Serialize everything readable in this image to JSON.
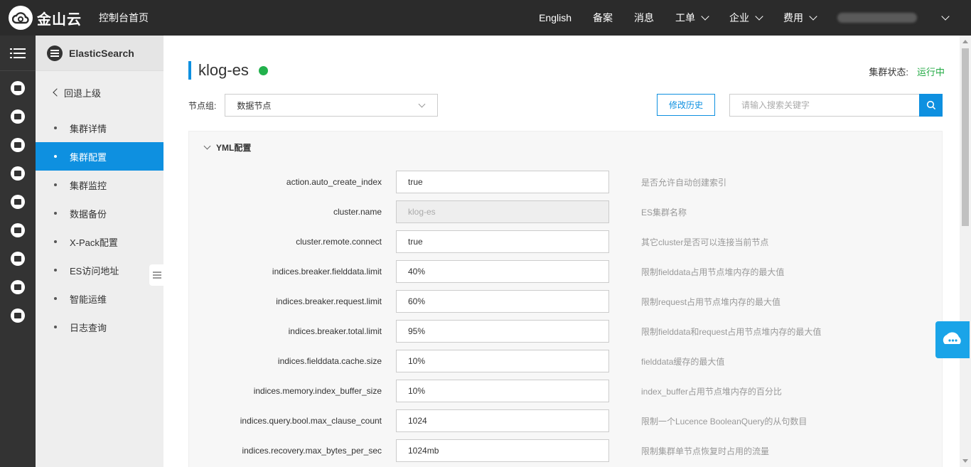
{
  "topbar": {
    "brand": "金山云",
    "console_home": "控制台首页",
    "nav": [
      {
        "label": "English",
        "has_dropdown": false
      },
      {
        "label": "备案",
        "has_dropdown": false
      },
      {
        "label": "消息",
        "has_dropdown": false
      },
      {
        "label": "工单",
        "has_dropdown": true
      },
      {
        "label": "企业",
        "has_dropdown": true
      },
      {
        "label": "费用",
        "has_dropdown": true
      }
    ]
  },
  "rail": {
    "icons": [
      "menu-icon",
      "database-icon",
      "server-icon",
      "network-icon",
      "cloud-icon",
      "storage-icon",
      "layers-icon",
      "cloud-upload-icon",
      "mail-icon",
      "id-card-icon"
    ]
  },
  "sidebar": {
    "product": "ElasticSearch",
    "back": "回退上级",
    "items": [
      {
        "label": "集群详情",
        "active": false
      },
      {
        "label": "集群配置",
        "active": true
      },
      {
        "label": "集群监控",
        "active": false
      },
      {
        "label": "数据备份",
        "active": false
      },
      {
        "label": "X-Pack配置",
        "active": false
      },
      {
        "label": "ES访问地址",
        "active": false
      },
      {
        "label": "智能运维",
        "active": false
      },
      {
        "label": "日志查询",
        "active": false
      }
    ]
  },
  "main": {
    "title": "klog-es",
    "status_label": "集群状态:",
    "status_value": "运行中",
    "status_color": "#22aa44",
    "node_group_label": "节点组:",
    "node_group_value": "数据节点",
    "history_button": "修改历史",
    "search_placeholder": "请输入搜索关键字",
    "section_title": "YML配置",
    "config": [
      {
        "key": "action.auto_create_index",
        "value": "true",
        "desc": "是否允许自动创建索引",
        "disabled": false
      },
      {
        "key": "cluster.name",
        "value": "klog-es",
        "desc": "ES集群名称",
        "disabled": true
      },
      {
        "key": "cluster.remote.connect",
        "value": "true",
        "desc": "其它cluster是否可以连接当前节点",
        "disabled": false
      },
      {
        "key": "indices.breaker.fielddata.limit",
        "value": "40%",
        "desc": "限制fielddata占用节点堆内存的最大值",
        "disabled": false
      },
      {
        "key": "indices.breaker.request.limit",
        "value": "60%",
        "desc": "限制request占用节点堆内存的最大值",
        "disabled": false
      },
      {
        "key": "indices.breaker.total.limit",
        "value": "95%",
        "desc": "限制fielddata和request占用节点堆内存的最大值",
        "disabled": false
      },
      {
        "key": "indices.fielddata.cache.size",
        "value": "10%",
        "desc": "fielddata缓存的最大值",
        "disabled": false
      },
      {
        "key": "indices.memory.index_buffer_size",
        "value": "10%",
        "desc": "index_buffer占用节点堆内存的百分比",
        "disabled": false
      },
      {
        "key": "indices.query.bool.max_clause_count",
        "value": "1024",
        "desc": "限制一个Lucence BooleanQuery的从句数目",
        "disabled": false
      },
      {
        "key": "indices.recovery.max_bytes_per_sec",
        "value": "1024mb",
        "desc": "限制集群单节点恢复时占用的流量",
        "disabled": false
      }
    ]
  },
  "colors": {
    "accent": "#0e90e0",
    "topbar": "#2b2b2b",
    "rail": "#333333",
    "status_dot": "#22b14c"
  }
}
